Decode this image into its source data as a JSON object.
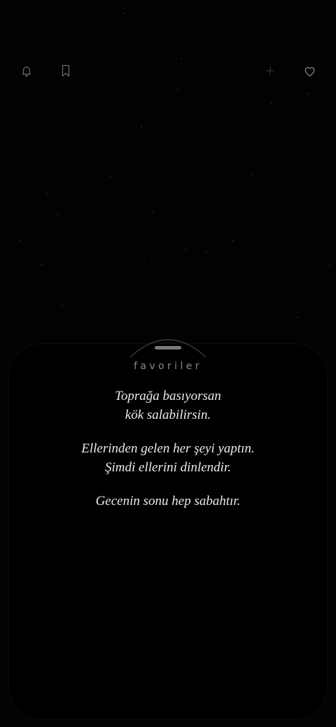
{
  "toolbar": {
    "left_icons": [
      "bell-icon",
      "bookmark-icon"
    ],
    "right_icons": [
      "plus-icon",
      "heart-icon"
    ]
  },
  "sheet": {
    "title": "favoriler",
    "quotes": [
      {
        "lines": [
          "Toprağa basıyorsan",
          "kök salabilirsin."
        ]
      },
      {
        "lines": [
          "Ellerinden gelen her şeyi yaptın.",
          "Şimdi ellerini dinlendir."
        ]
      },
      {
        "lines": [
          "Gecenin sonu hep sabahtır."
        ]
      }
    ]
  },
  "colors": {
    "background": "#020202",
    "text": "#ececec",
    "muted": "#8a8a8a",
    "icon": "#6e6e6e"
  }
}
